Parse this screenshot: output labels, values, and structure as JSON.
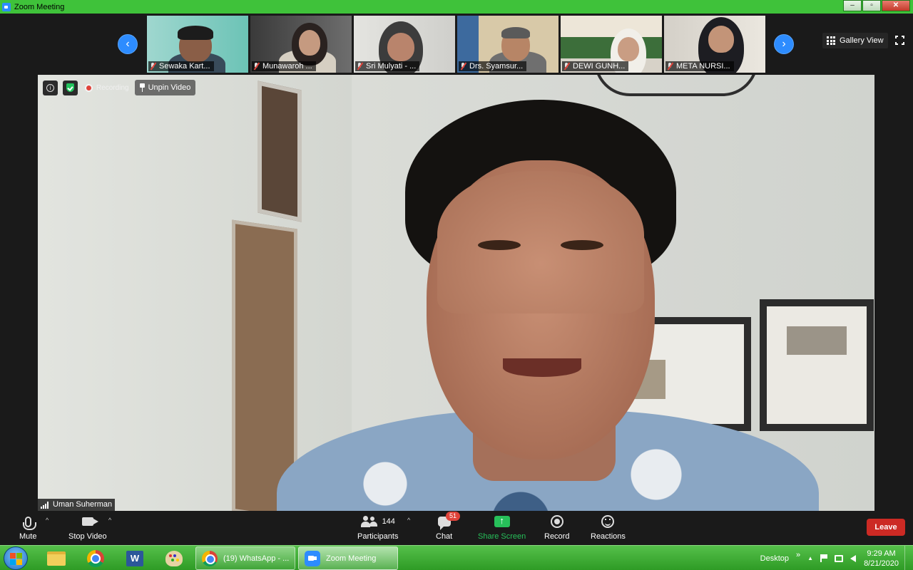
{
  "window": {
    "title": "Zoom Meeting",
    "controls": {
      "minimize": "‒",
      "maximize": "▫",
      "close": "✕"
    }
  },
  "thumbnails": [
    {
      "name": "Sewaka Kart..."
    },
    {
      "name": "Munawaroh ..."
    },
    {
      "name": "Sri Mulyati - ..."
    },
    {
      "name": "Drs. Syamsur..."
    },
    {
      "name": "DEWI GUNH..."
    },
    {
      "name": "META NURSI..."
    }
  ],
  "nav": {
    "prev": "‹",
    "next": "›"
  },
  "gallery_view": {
    "label": "Gallery View"
  },
  "main_video": {
    "speaker_name": "Uman Suherman",
    "recording_label": "Recording",
    "unpin_label": "Unpin Video",
    "info_glyph": "i"
  },
  "toolbar": {
    "mute": "Mute",
    "stop_video": "Stop Video",
    "participants": "Participants",
    "participants_count": "144",
    "chat": "Chat",
    "chat_badge": "51",
    "share_screen": "Share Screen",
    "record": "Record",
    "reactions": "Reactions",
    "leave": "Leave",
    "caret": "^"
  },
  "taskbar": {
    "word_letter": "W",
    "tasks": [
      {
        "label": "(19) WhatsApp - ..."
      },
      {
        "label": "Zoom Meeting"
      }
    ],
    "desktop_label": "Desktop",
    "chevrons": "»",
    "tray_up": "▲",
    "time": "9:29 AM",
    "date": "8/21/2020"
  },
  "colors": {
    "titlebar": "#3fc23a",
    "accent_blue": "#2d8cff",
    "share_green": "#27c05a",
    "leave_red": "#cc2a24",
    "badge_red": "#e0433a"
  }
}
